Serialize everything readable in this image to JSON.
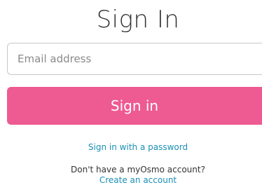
{
  "title": "Sign In",
  "email": {
    "placeholder": "Email address",
    "value": ""
  },
  "signin_button": {
    "label": "Sign in",
    "color": "#ee5a92"
  },
  "links": {
    "password": "Sign in with a password",
    "no_account_text": "Don't have a myOsmo account?",
    "create_account": "Create an account",
    "link_color": "#1a8fb5"
  }
}
